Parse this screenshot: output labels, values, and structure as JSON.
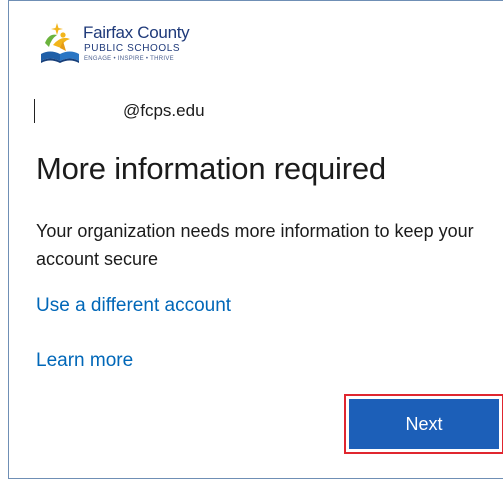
{
  "logo": {
    "title": "Fairfax County",
    "subtitle": "PUBLIC SCHOOLS",
    "tagline": "ENGAGE • INSPIRE • THRIVE"
  },
  "account": {
    "email_suffix": "@fcps.edu"
  },
  "main": {
    "title": "More information required",
    "description": "Your organization needs more information to keep your account secure",
    "use_different_account_link": "Use a different account",
    "learn_more_link": "Learn more"
  },
  "actions": {
    "next_label": "Next"
  },
  "colors": {
    "link": "#0067b8",
    "primary_button": "#1c5fb8",
    "highlight_border": "#e0262f",
    "brand_navy": "#1f3a7a"
  },
  "icons": {
    "logo_mark": "fcps-logo-icon"
  }
}
